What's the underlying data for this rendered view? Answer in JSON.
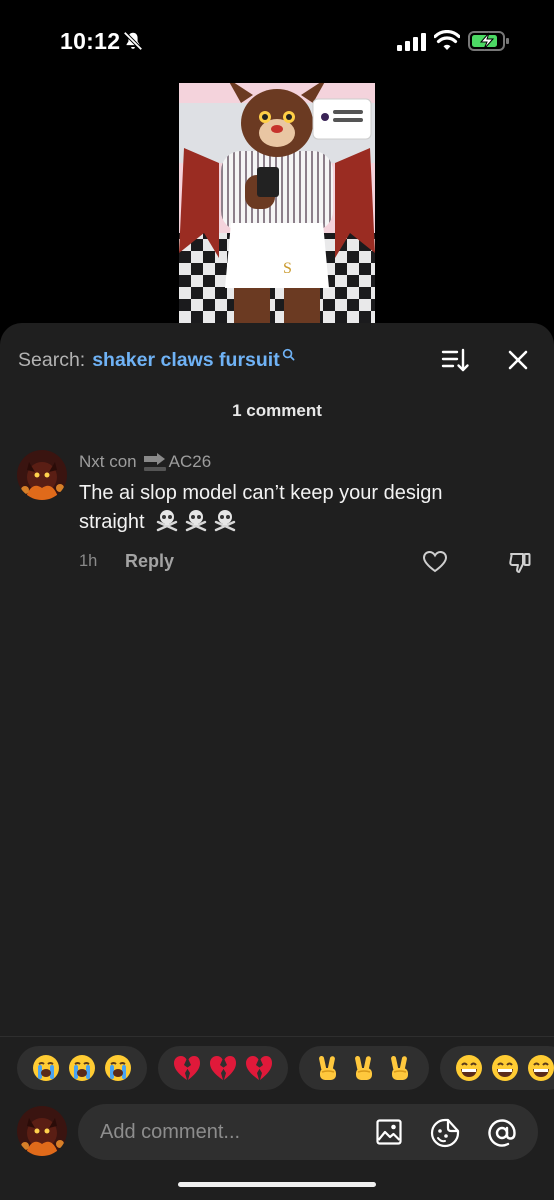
{
  "status_bar": {
    "time": "10:12"
  },
  "search": {
    "prefix": "Search:",
    "term": "shaker claws fursuit"
  },
  "comments": {
    "count_label": "1 comment",
    "items": [
      {
        "username_start": "Nxt con",
        "username_end": "AC26",
        "text": "The ai slop model can’t keep your design straight",
        "time": "1h",
        "reply_label": "Reply"
      }
    ]
  },
  "quick_emojis": [
    {
      "emoji": "😭😭😭",
      "icon": "loudly-crying-face-icon"
    },
    {
      "emoji": "💔💔💔",
      "icon": "broken-heart-icon"
    },
    {
      "emoji": "✌️✌️✌️",
      "icon": "victory-hand-icon"
    },
    {
      "emoji": "😁😁😁",
      "icon": "beaming-face-icon"
    }
  ],
  "input": {
    "placeholder": "Add comment..."
  },
  "colors": {
    "sheet": "#1f1f1f",
    "link": "#6fb2f5",
    "chip": "#2f2f2f"
  }
}
